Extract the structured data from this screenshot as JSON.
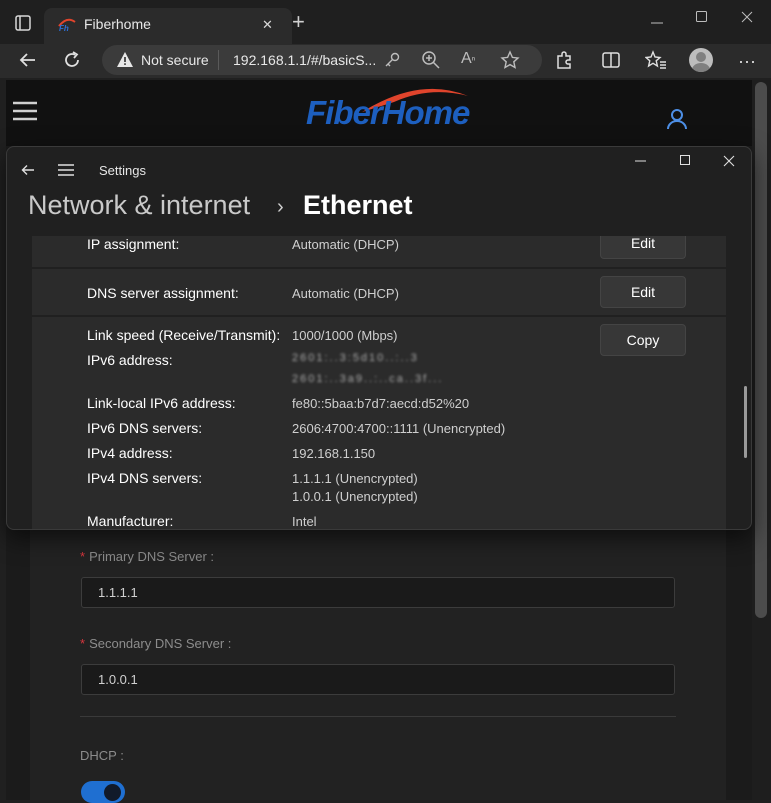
{
  "browser": {
    "tab_title": "Fiberhome",
    "not_secure": "Not secure",
    "url": "192.168.1.1/#/basicS...",
    "new_tab_glyph": "+",
    "close_tab_glyph": "✕"
  },
  "page": {
    "logo": "FiberHome",
    "primary_dns_label": "Primary DNS Server :",
    "primary_dns_value": "1.1.1.1",
    "secondary_dns_label": "Secondary DNS Server :",
    "secondary_dns_value": "1.0.0.1",
    "dhcp_label": "DHCP :",
    "required_mark": "*",
    "dhcp_enabled": true,
    "toggle_color": "#1f6fd1"
  },
  "settings": {
    "window_title": "Settings",
    "breadcrumb_parent": "Network & internet",
    "breadcrumb_sep": "›",
    "breadcrumb_current": "Ethernet",
    "rows": {
      "ip_assignment": {
        "label": "IP assignment:",
        "value": "Automatic (DHCP)",
        "button": "Edit"
      },
      "dns_assignment": {
        "label": "DNS server assignment:",
        "value": "Automatic (DHCP)",
        "button": "Edit"
      },
      "link_speed": {
        "label": "Link speed (Receive/Transmit):",
        "value": "1000/1000 (Mbps)",
        "button": "Copy"
      },
      "ipv6_address": {
        "label": "IPv6 address:",
        "value_partial_1": "2601:..3:5d10..:..3",
        "value_partial_2": "2601:..3a9..:..ca..3f..."
      },
      "link_local": {
        "label": "Link-local IPv6 address:",
        "value": "fe80::5baa:b7d7:aecd:d52%20"
      },
      "ipv6_dns": {
        "label": "IPv6 DNS servers:",
        "value": "2606:4700:4700::1111 (Unencrypted)"
      },
      "ipv4_address": {
        "label": "IPv4 address:",
        "value": "192.168.1.150"
      },
      "ipv4_dns": {
        "label": "IPv4 DNS servers:",
        "value_1": "1.1.1.1 (Unencrypted)",
        "value_2": "1.0.0.1 (Unencrypted)"
      },
      "manufacturer": {
        "label": "Manufacturer:",
        "value": "Intel"
      }
    }
  }
}
